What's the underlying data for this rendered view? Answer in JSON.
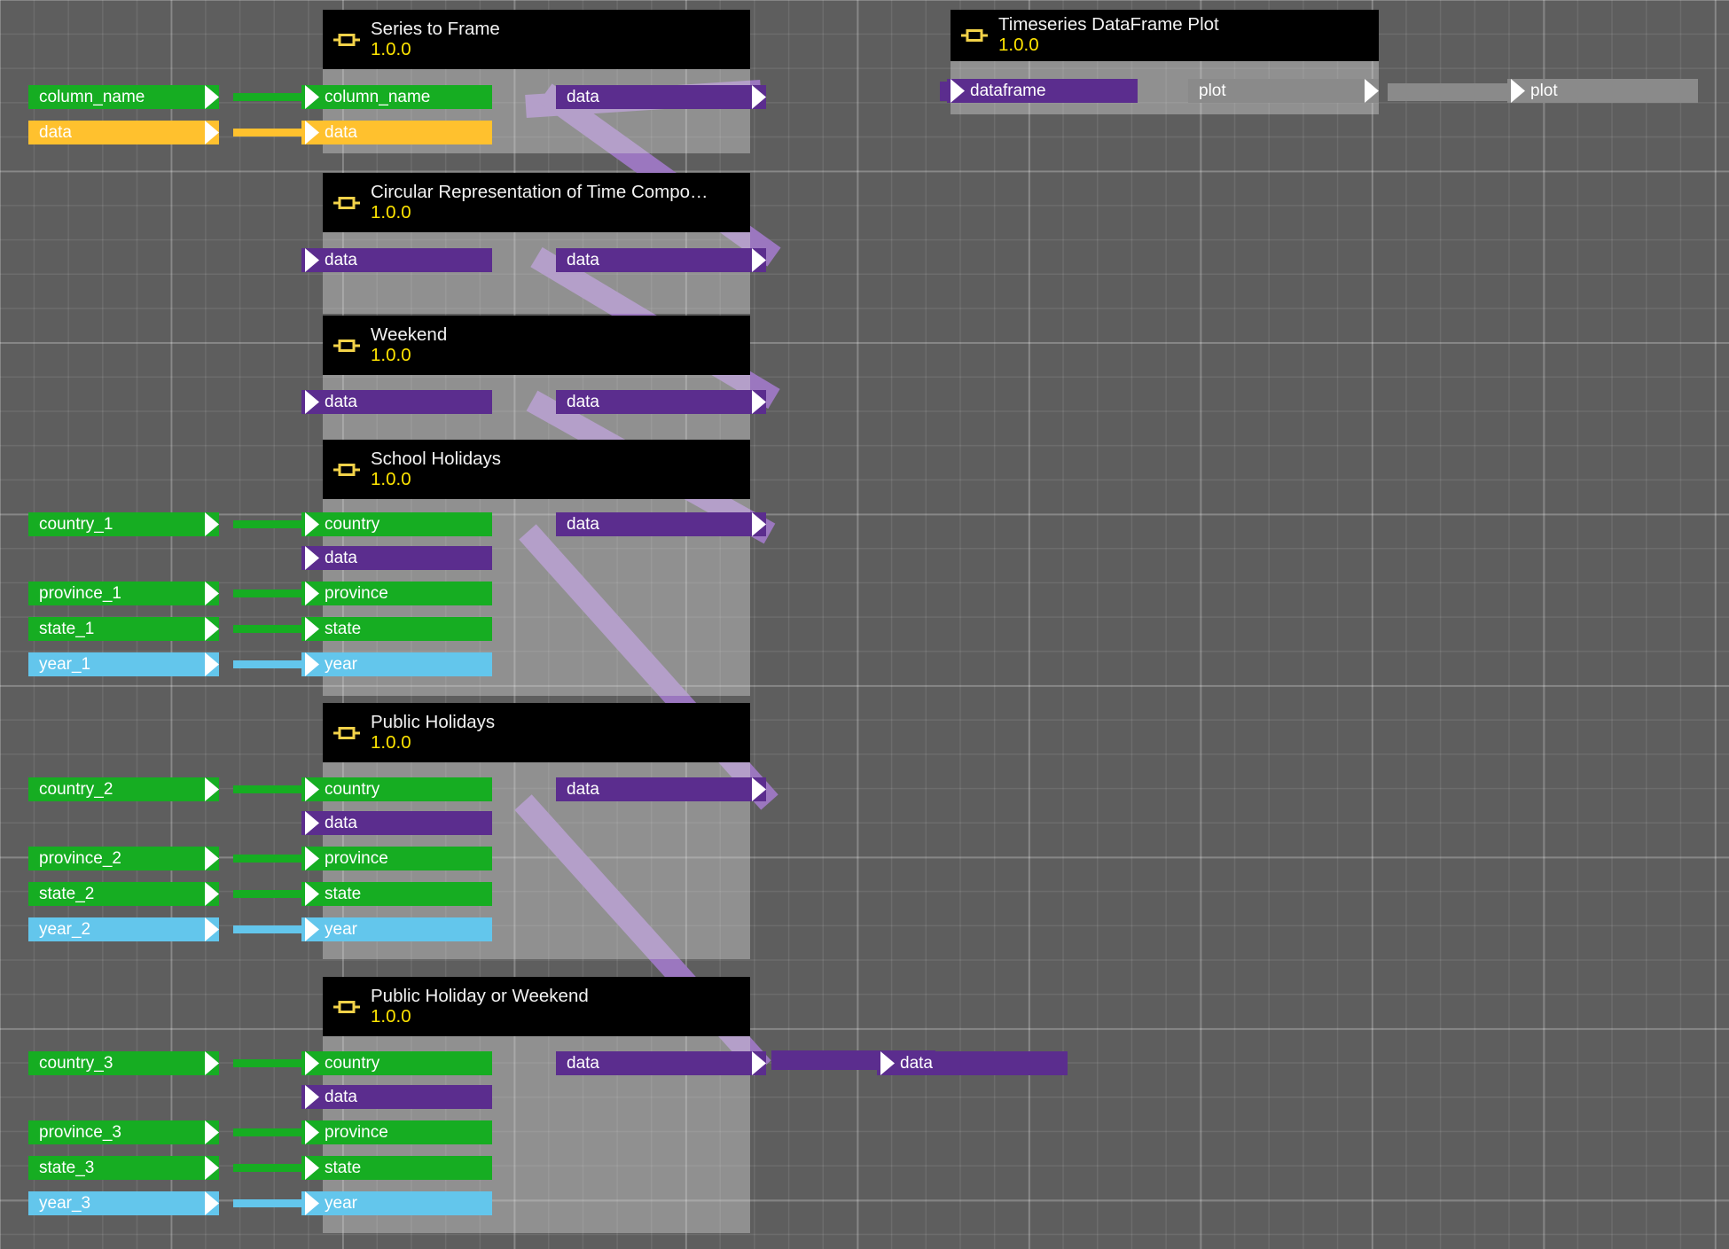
{
  "editor": {
    "name": "node-graph-canvas",
    "background_color": "#5e5e5e",
    "grid_color": "#7a7a7a"
  },
  "colors": {
    "header_bg": "#000000",
    "version_text": "#ffe400",
    "title_text": "#f2f2f2",
    "icon": "#f2d249",
    "type_dataframe": "#5b2d8e",
    "type_string": "#16ad22",
    "type_series": "#ffc12e",
    "type_int": "#63c6ec",
    "type_plot": "#8a8a8a",
    "link_dataframe": "#9b77bf",
    "node_body": "#d7d7d7"
  },
  "nodes": [
    {
      "id": "series-to-frame",
      "title": "Series to Frame",
      "version": "1.0.0",
      "icon": "component-icon",
      "inputs": [
        {
          "label": "column_name",
          "type": "string"
        },
        {
          "label": "data",
          "type": "series"
        }
      ],
      "outputs": [
        {
          "label": "data",
          "type": "dataframe"
        }
      ]
    },
    {
      "id": "circular-representation-of-time-components",
      "title": "Circular Representation of Time Compo…",
      "version": "1.0.0",
      "icon": "component-icon",
      "inputs": [
        {
          "label": "data",
          "type": "dataframe"
        }
      ],
      "outputs": [
        {
          "label": "data",
          "type": "dataframe"
        }
      ]
    },
    {
      "id": "weekend",
      "title": "Weekend",
      "version": "1.0.0",
      "icon": "component-icon",
      "inputs": [
        {
          "label": "data",
          "type": "dataframe"
        }
      ],
      "outputs": [
        {
          "label": "data",
          "type": "dataframe"
        }
      ]
    },
    {
      "id": "school-holidays",
      "title": "School Holidays",
      "version": "1.0.0",
      "icon": "component-icon",
      "inputs": [
        {
          "label": "country",
          "type": "string"
        },
        {
          "label": "data",
          "type": "dataframe"
        },
        {
          "label": "province",
          "type": "string"
        },
        {
          "label": "state",
          "type": "string"
        },
        {
          "label": "year",
          "type": "int"
        }
      ],
      "outputs": [
        {
          "label": "data",
          "type": "dataframe"
        }
      ]
    },
    {
      "id": "public-holidays",
      "title": "Public Holidays",
      "version": "1.0.0",
      "icon": "component-icon",
      "inputs": [
        {
          "label": "country",
          "type": "string"
        },
        {
          "label": "data",
          "type": "dataframe"
        },
        {
          "label": "province",
          "type": "string"
        },
        {
          "label": "state",
          "type": "string"
        },
        {
          "label": "year",
          "type": "int"
        }
      ],
      "outputs": [
        {
          "label": "data",
          "type": "dataframe"
        }
      ]
    },
    {
      "id": "public-holiday-or-weekend",
      "title": "Public Holiday or Weekend",
      "version": "1.0.0",
      "icon": "component-icon",
      "inputs": [
        {
          "label": "country",
          "type": "string"
        },
        {
          "label": "data",
          "type": "dataframe"
        },
        {
          "label": "province",
          "type": "string"
        },
        {
          "label": "state",
          "type": "string"
        },
        {
          "label": "year",
          "type": "int"
        }
      ],
      "outputs": [
        {
          "label": "data",
          "type": "dataframe"
        }
      ]
    },
    {
      "id": "timeseries-dataframe-plot",
      "title": "Timeseries DataFrame Plot",
      "version": "1.0.0",
      "icon": "component-icon",
      "inputs": [
        {
          "label": "dataframe",
          "type": "dataframe"
        }
      ],
      "outputs": [
        {
          "label": "plot",
          "type": "plot"
        }
      ]
    }
  ],
  "workflow_inputs": [
    {
      "label": "column_name",
      "type": "string"
    },
    {
      "label": "data",
      "type": "series"
    },
    {
      "label": "country_1",
      "type": "string"
    },
    {
      "label": "province_1",
      "type": "string"
    },
    {
      "label": "state_1",
      "type": "string"
    },
    {
      "label": "year_1",
      "type": "int"
    },
    {
      "label": "country_2",
      "type": "string"
    },
    {
      "label": "province_2",
      "type": "string"
    },
    {
      "label": "state_2",
      "type": "string"
    },
    {
      "label": "year_2",
      "type": "int"
    },
    {
      "label": "country_3",
      "type": "string"
    },
    {
      "label": "province_3",
      "type": "string"
    },
    {
      "label": "state_3",
      "type": "string"
    },
    {
      "label": "year_3",
      "type": "int"
    }
  ],
  "workflow_outputs": [
    {
      "label": "plot",
      "type": "plot"
    },
    {
      "label": "data",
      "type": "dataframe"
    }
  ]
}
